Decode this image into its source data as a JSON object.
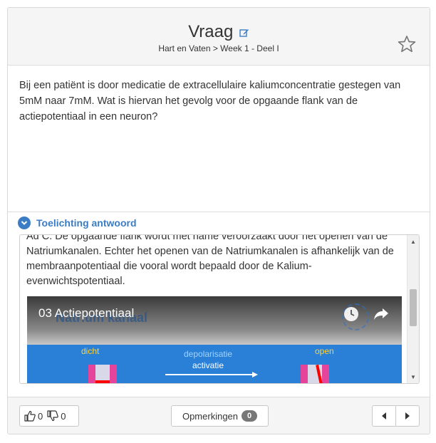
{
  "header": {
    "title": "Vraag",
    "breadcrumb": "Hart en Vaten > Week 1 - Deel I",
    "edit_icon": "edit-icon",
    "favorite_icon": "star-outline-icon"
  },
  "question": {
    "text": "Bij een patiënt is door medicatie de extracellulaire kaliumconcentratie gestegen van 5mM naar 7mM. Wat is hiervan het gevolg voor de opgaande flank van de actiepotentiaal in een neuron?"
  },
  "explanation": {
    "toggle_label": "Toelichting antwoord",
    "toggle_icon": "chevron-down-circle-icon",
    "text": "Ad C. De opgaande flank wordt met name veroorzaakt door het openen van de Natriumkanalen. Echter het openen van de Natriumkanalen is afhankelijk van de membraanpotentiaal die vooral wordt bepaald door de Kalium-evenwichtspotentiaal.",
    "video": {
      "title": "03 Actiepotentiaal",
      "slide_title": "Natrium kanaal",
      "label_closed": "dicht",
      "label_depol": "depolarisatie",
      "label_activation": "activatie",
      "label_open": "open"
    }
  },
  "footer": {
    "likes": "0",
    "dislikes": "0",
    "comments_label": "Opmerkingen",
    "comments_count": "0"
  },
  "colors": {
    "accent": "#3b7dc4",
    "badge": "#777777",
    "channel": "#e6449b"
  }
}
